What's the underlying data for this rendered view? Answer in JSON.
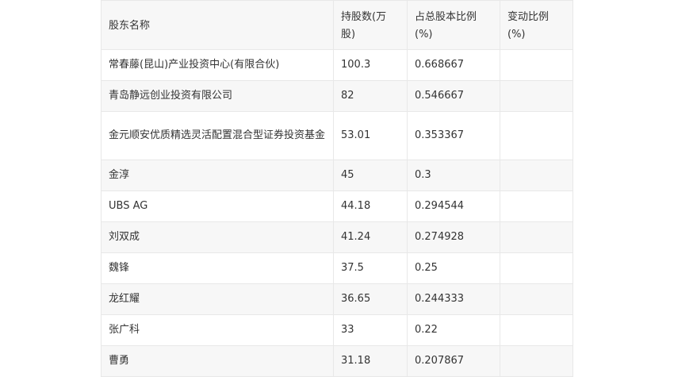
{
  "table": {
    "headers": [
      "股东名称",
      "持股数(万股)",
      "占总股本比例(%)",
      "变动比例(%)"
    ],
    "rows": [
      {
        "name": "常春藤(昆山)产业投资中心(有限合伙)",
        "shares": "100.3",
        "ratio": "0.668667",
        "change": ""
      },
      {
        "name": "青岛静远创业投资有限公司",
        "shares": "82",
        "ratio": "0.546667",
        "change": ""
      },
      {
        "name": "金元顺安优质精选灵活配置混合型证券投资基金",
        "shares": "53.01",
        "ratio": "0.353367",
        "change": ""
      },
      {
        "name": "金淳",
        "shares": "45",
        "ratio": "0.3",
        "change": ""
      },
      {
        "name": "UBS AG",
        "shares": "44.18",
        "ratio": "0.294544",
        "change": ""
      },
      {
        "name": "刘双成",
        "shares": "41.24",
        "ratio": "0.274928",
        "change": ""
      },
      {
        "name": "魏锋",
        "shares": "37.5",
        "ratio": "0.25",
        "change": ""
      },
      {
        "name": "龙红耀",
        "shares": "36.65",
        "ratio": "0.244333",
        "change": ""
      },
      {
        "name": "张广科",
        "shares": "33",
        "ratio": "0.22",
        "change": ""
      },
      {
        "name": "曹勇",
        "shares": "31.18",
        "ratio": "0.207867",
        "change": ""
      }
    ]
  }
}
